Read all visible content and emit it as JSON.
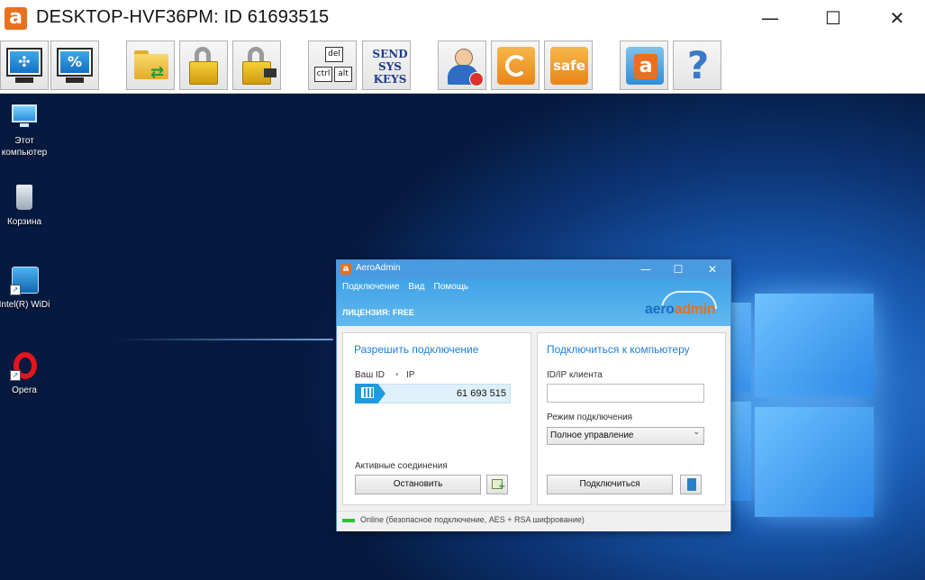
{
  "window": {
    "title": "DESKTOP-HVF36PM: ID 61693515",
    "logo_letter": "a",
    "minimize_glyph": "—",
    "maximize_glyph": "☐",
    "close_glyph": "✕"
  },
  "toolbar": {
    "buttons": [
      {
        "name": "fit-screen",
        "icon": "monitor-arrows-icon",
        "glyph": "✣"
      },
      {
        "name": "scale",
        "icon": "monitor-percent-icon",
        "glyph": "%"
      },
      {
        "name": "file-transfer",
        "icon": "folder-transfer-icon",
        "glyph": "⇄"
      },
      {
        "name": "block-input",
        "icon": "padlock-icon"
      },
      {
        "name": "block-input-power",
        "icon": "padlock-plug-icon"
      },
      {
        "name": "ctrl-alt-del",
        "icon": "keyboard-keys-icon",
        "keys": [
          "del",
          "ctrl",
          "alt"
        ]
      },
      {
        "name": "send-sys-keys",
        "icon": "send-sys-keys-icon",
        "text": "SEND SYS KEYS"
      },
      {
        "name": "user",
        "icon": "user-icon"
      },
      {
        "name": "restart",
        "icon": "restart-icon"
      },
      {
        "name": "safe-mode",
        "icon": "safe-mode-icon",
        "text": "safe"
      },
      {
        "name": "aeroadmin",
        "icon": "aeroadmin-logo-icon",
        "text": "a"
      },
      {
        "name": "help",
        "icon": "help-icon",
        "text": "?"
      }
    ]
  },
  "desktop": {
    "icons": [
      {
        "label": "Этот\nкомпьютер",
        "icon": "computer-icon"
      },
      {
        "label": "Корзина",
        "icon": "recycle-bin-icon"
      },
      {
        "label": "Intel(R) WiDi",
        "icon": "intel-widi-icon"
      },
      {
        "label": "Opera",
        "icon": "opera-icon"
      }
    ]
  },
  "aero": {
    "title": "AeroAdmin",
    "logo_letter": "a",
    "minimize_glyph": "—",
    "maximize_glyph": "☐",
    "close_glyph": "✕",
    "menu": [
      "Подключение",
      "Вид",
      "Помощь"
    ],
    "license": "ЛИЦЕНЗИЯ: FREE",
    "brand_part1": "aero",
    "brand_part2": "admin",
    "left": {
      "title": "Разрешить подключение",
      "your_id_label": "Ваш ID",
      "ip_label": "IP",
      "id_value": "61 693 515",
      "active_label": "Активные соединения",
      "stop_button": "Остановить"
    },
    "right": {
      "title": "Подключиться к компьютеру",
      "client_label": "ID/IP клиента",
      "client_value": "",
      "mode_label": "Режим подключения",
      "mode_value": "Полное управление",
      "connect_button": "Подключиться"
    },
    "status": "Online (безопасное подключение, AES + RSA шифрование)",
    "status_color": "#2ac33a"
  }
}
